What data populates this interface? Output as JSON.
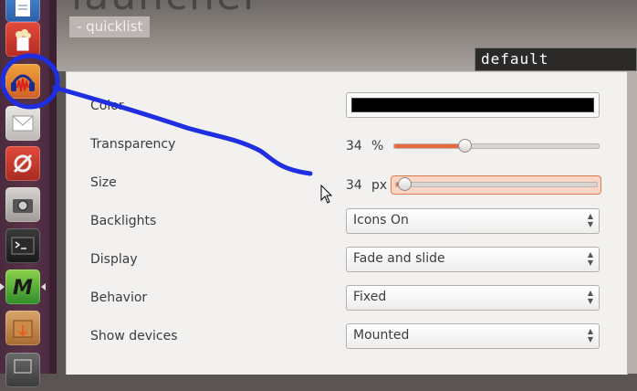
{
  "header": {
    "title": "launcher",
    "subtitle": "- quicklist",
    "section_label": "default settings"
  },
  "launcher": {
    "icons": [
      "document-icon",
      "popcorn-icon",
      "audacity-icon",
      "mail-icon",
      "settings-tools-icon",
      "camera-icon",
      "terminal-icon",
      "m-app-icon",
      "package-icon",
      "window-icon"
    ]
  },
  "settings": {
    "color": {
      "label": "Color",
      "value": "#000000"
    },
    "transparency": {
      "label": "Transparency",
      "value": "34",
      "unit": "%",
      "fraction": 0.34
    },
    "size": {
      "label": "Size",
      "value": "34",
      "unit": "px",
      "fraction": 0.04
    },
    "backlights": {
      "label": "Backlights",
      "selected": "Icons On"
    },
    "display": {
      "label": "Display",
      "selected": "Fade and slide"
    },
    "behavior": {
      "label": "Behavior",
      "selected": "Fixed"
    },
    "show_devices": {
      "label": "Show devices",
      "selected": "Mounted"
    }
  },
  "annotation_color": "#1f2ee0",
  "accent_color": "#e9683b"
}
